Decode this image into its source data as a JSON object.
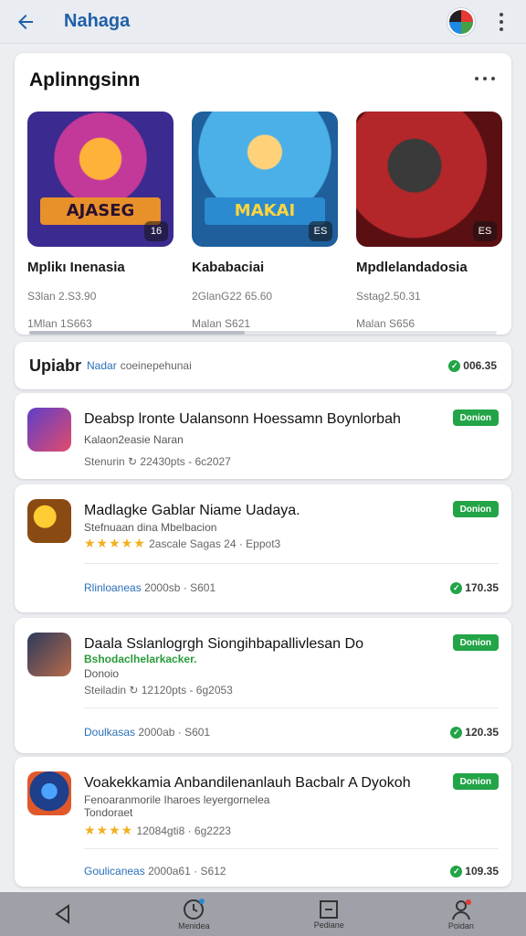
{
  "appbar": {
    "title": "Nahaga"
  },
  "featured": {
    "title": "Aplinngsinn",
    "tiles": [
      {
        "banner": "AJASEG",
        "badge": "16",
        "name": "Mplikı Inenasia",
        "meta1": "S3lan 2.S3.90",
        "meta2": "1Mlan 1S663"
      },
      {
        "banner": "MAKAI",
        "badge": "ES",
        "name": "Kababaciai",
        "meta1": "2GlanG22 65.60",
        "meta2": "Malan S621"
      },
      {
        "banner": "",
        "badge": "ES",
        "name": "Mpdlelandadosia",
        "meta1": "Sstag2.50.31",
        "meta2": "Malan S656"
      }
    ]
  },
  "updates": {
    "title": "Upiabr",
    "tag": "Nadar",
    "subtitle": "coeinepehunai",
    "status": "006.35"
  },
  "apps": [
    {
      "title": "Deabsp lronte Ualansonn Hoessamn Boynlorbah",
      "sub": "Kalaon2easie Naran",
      "meta": "Stenurin  ↻ 22430pts - 6c2027",
      "button": "Donion"
    },
    {
      "title": "Madlagke Gablar Niame Uadaya.",
      "sub": "Stefnuaan dina Mbelbacion",
      "stars": "★★★★★",
      "meta": "2ascale  Sagas 24  · Eppot3",
      "button": "Donion",
      "foot_link": "Rlinloaneas",
      "foot_meta": "2000sb · S601",
      "status": "170.35"
    },
    {
      "title": "Daala Sslanlogrgh Siongihbapallivlesan Do",
      "sub": "Bshodaclhelarkacker.",
      "sub2": "Donoio",
      "meta": "Steiladin  ↻ 12120pts - 6g2053",
      "button": "Donion",
      "foot_link": "Doulkasas",
      "foot_meta": "2000ab · S601",
      "status": "120.35"
    },
    {
      "title": "Voakekkamia Anbandilenanlauh Bacbalr A Dyokoh",
      "sub": "Fenoaranmorile Iharoes leyergornelea",
      "sub2": "Tondoraet",
      "stars": "★★★★",
      "meta": "12084gti8 · 6g2223",
      "button": "Donion",
      "foot_link": "Goulicaneas",
      "foot_meta": "2000a61 · S612",
      "status": "109.35"
    }
  ],
  "bottomnav": [
    {
      "icon": "back-triangle-icon",
      "label": ""
    },
    {
      "icon": "clock-icon",
      "label": "Menidea"
    },
    {
      "icon": "square-icon",
      "label": "Pediane"
    },
    {
      "icon": "person-icon",
      "label": "Poidan"
    }
  ]
}
